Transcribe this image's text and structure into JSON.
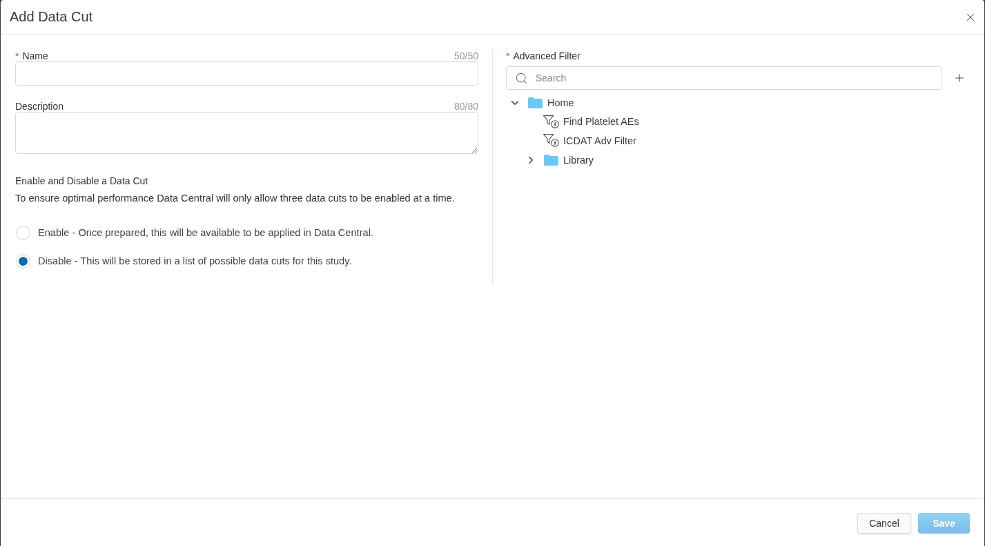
{
  "dialog": {
    "title": "Add Data Cut"
  },
  "name_field": {
    "required_mark": "*",
    "label": "Name",
    "counter": "50/50"
  },
  "description_field": {
    "label": "Description",
    "counter": "80/80"
  },
  "enable_section": {
    "heading": "Enable and Disable a Data Cut",
    "text": "To ensure optimal performance Data Central will only allow three data cuts to be enabled at a time.",
    "options": [
      {
        "label": "Enable - Once prepared, this will be available to be applied in Data Central.",
        "selected": false
      },
      {
        "label": "Disable - This will be stored in a list of possible data cuts for this study.",
        "selected": true
      }
    ]
  },
  "advanced_filter": {
    "required_mark": "*",
    "label": "Advanced Filter",
    "search": {
      "placeholder": "Search"
    },
    "tree": [
      {
        "kind": "folder",
        "label": "Home",
        "expanded": true,
        "children": [
          {
            "kind": "filter",
            "label": "Find Platelet AEs"
          },
          {
            "kind": "filter",
            "label": "ICDAT Adv Filter"
          },
          {
            "kind": "folder",
            "label": "Library",
            "expanded": false
          }
        ]
      }
    ]
  },
  "buttons": [
    {
      "kind": "secondary",
      "label": "Cancel",
      "disabled": false
    },
    {
      "kind": "primary",
      "label": "Save",
      "disabled": true
    }
  ]
}
